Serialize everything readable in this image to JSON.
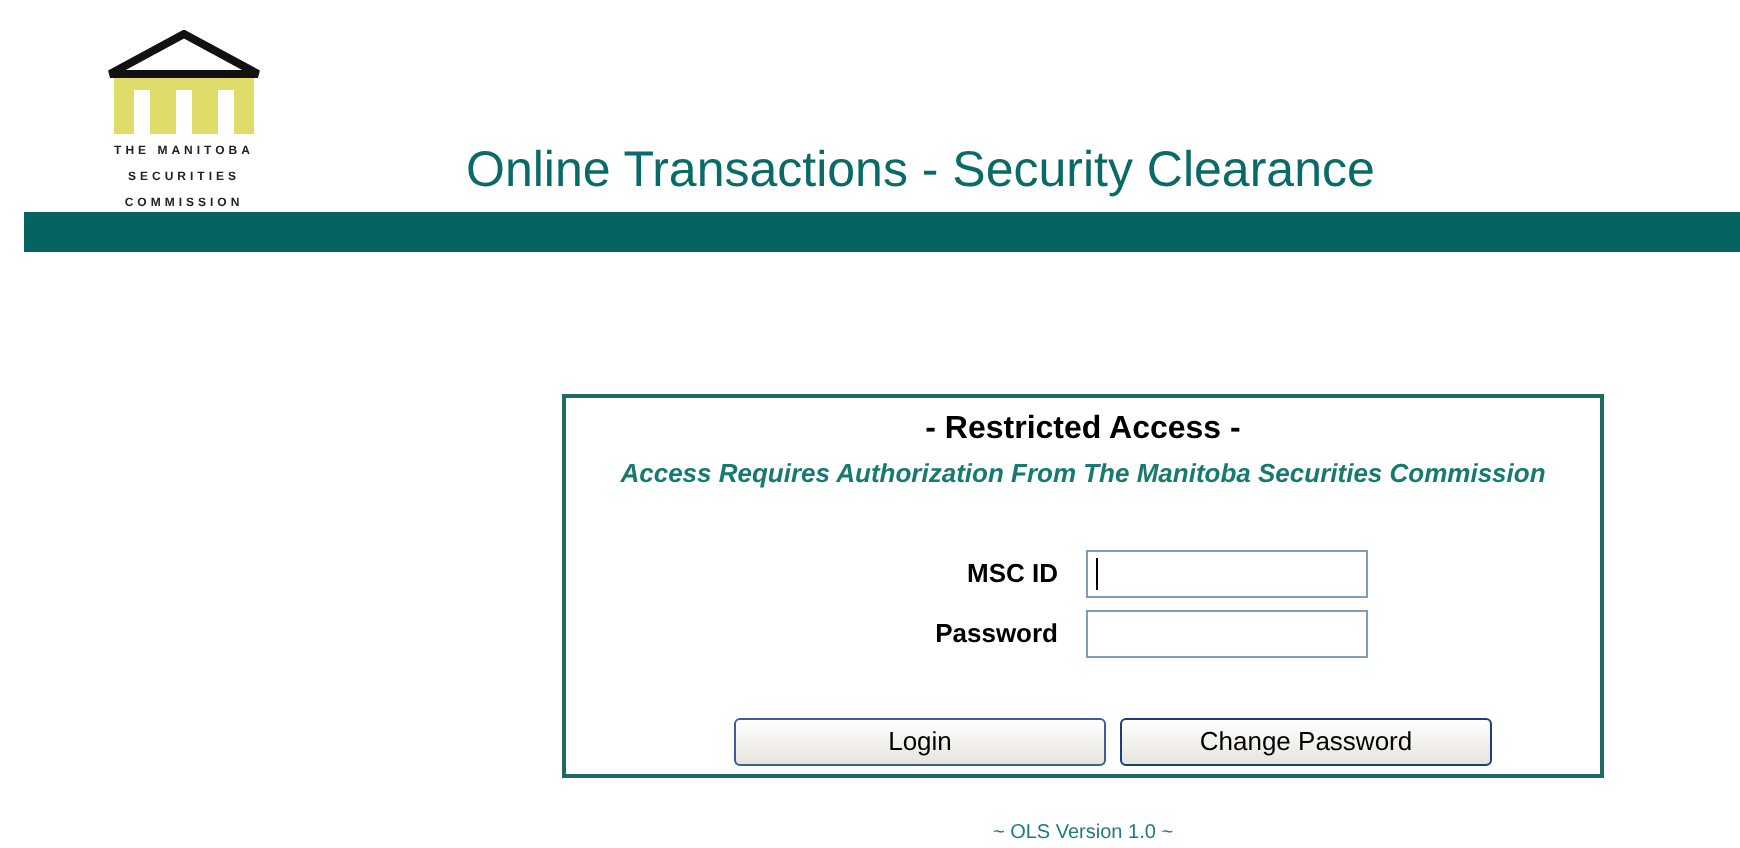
{
  "logo": {
    "lines": [
      "THE MANITOBA",
      "SECURITIES",
      "COMMISSION"
    ]
  },
  "header": {
    "title": "Online Transactions - Security Clearance"
  },
  "login_panel": {
    "heading": "- Restricted Access -",
    "subheading": "Access Requires Authorization From The Manitoba Securities Commission",
    "fields": [
      {
        "label": "MSC ID",
        "focused": true
      },
      {
        "label": "Password",
        "focused": false
      }
    ],
    "buttons": [
      "Login",
      "Change Password"
    ]
  },
  "footer": {
    "version": "~ OLS Version 1.0 ~"
  }
}
